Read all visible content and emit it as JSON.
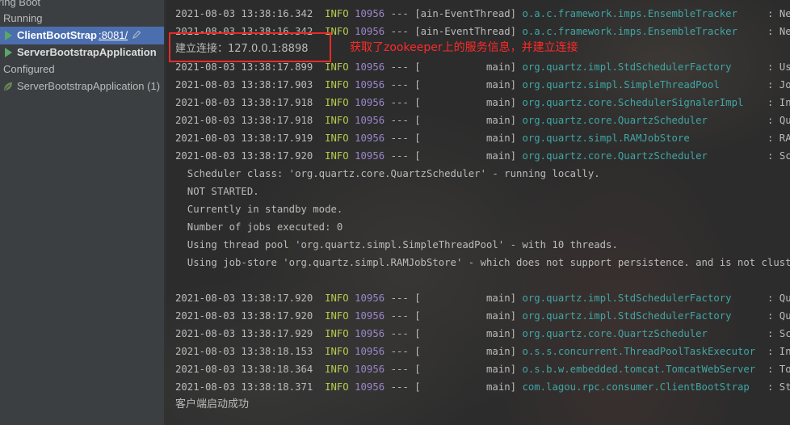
{
  "sidebar": {
    "items": [
      {
        "label": "ring Boot"
      },
      {
        "label": "Running"
      },
      {
        "label": "ClientBootStrap",
        "port": ":8081/"
      },
      {
        "label": "ServerBootstrapApplication"
      },
      {
        "label": "Configured"
      },
      {
        "label": "ServerBootstrapApplication (1)"
      }
    ]
  },
  "console": {
    "lines": [
      {
        "ts": "2021-08-03 13:38:16.342",
        "level": "INFO",
        "pid": "10956",
        "sep": "---",
        "thread": "[ain-EventThread]",
        "logger": "o.a.c.framework.imps.EnsembleTracker",
        "msg": ": New conf"
      },
      {
        "ts": "2021-08-03 13:38:16.342",
        "level": "INFO",
        "pid": "10956",
        "sep": "---",
        "thread": "[ain-EventThread]",
        "logger": "o.a.c.framework.imps.EnsembleTracker",
        "msg": ": New conf"
      },
      {
        "text": "建立连接：127.0.0.1:8898"
      },
      {
        "ts": "2021-08-03 13:38:17.899",
        "level": "INFO",
        "pid": "10956",
        "sep": "---",
        "thread": "[           main]",
        "logger": "org.quartz.impl.StdSchedulerFactory",
        "msg": ": Using de"
      },
      {
        "ts": "2021-08-03 13:38:17.903",
        "level": "INFO",
        "pid": "10956",
        "sep": "---",
        "thread": "[           main]",
        "logger": "org.quartz.simpl.SimpleThreadPool",
        "msg": ": Job exec"
      },
      {
        "ts": "2021-08-03 13:38:17.918",
        "level": "INFO",
        "pid": "10956",
        "sep": "---",
        "thread": "[           main]",
        "logger": "org.quartz.core.SchedulerSignalerImpl",
        "msg": ": Initiali"
      },
      {
        "ts": "2021-08-03 13:38:17.918",
        "level": "INFO",
        "pid": "10956",
        "sep": "---",
        "thread": "[           main]",
        "logger": "org.quartz.core.QuartzScheduler",
        "msg": ": Quartz S"
      },
      {
        "ts": "2021-08-03 13:38:17.919",
        "level": "INFO",
        "pid": "10956",
        "sep": "---",
        "thread": "[           main]",
        "logger": "org.quartz.simpl.RAMJobStore",
        "msg": ": RAMJobSto"
      },
      {
        "ts": "2021-08-03 13:38:17.920",
        "level": "INFO",
        "pid": "10956",
        "sep": "---",
        "thread": "[           main]",
        "logger": "org.quartz.core.QuartzScheduler",
        "msg": ": Schedule"
      },
      {
        "text": "  Scheduler class: 'org.quartz.core.QuartzScheduler' - running locally."
      },
      {
        "text": "  NOT STARTED."
      },
      {
        "text": "  Currently in standby mode."
      },
      {
        "text": "  Number of jobs executed: 0"
      },
      {
        "text": "  Using thread pool 'org.quartz.simpl.SimpleThreadPool' - with 10 threads."
      },
      {
        "text": "  Using job-store 'org.quartz.simpl.RAMJobStore' - which does not support persistence. and is not clustered."
      },
      {
        "text": ""
      },
      {
        "ts": "2021-08-03 13:38:17.920",
        "level": "INFO",
        "pid": "10956",
        "sep": "---",
        "thread": "[           main]",
        "logger": "org.quartz.impl.StdSchedulerFactory",
        "msg": ": Quartz s"
      },
      {
        "ts": "2021-08-03 13:38:17.920",
        "level": "INFO",
        "pid": "10956",
        "sep": "---",
        "thread": "[           main]",
        "logger": "org.quartz.impl.StdSchedulerFactory",
        "msg": ": Quartz s"
      },
      {
        "ts": "2021-08-03 13:38:17.929",
        "level": "INFO",
        "pid": "10956",
        "sep": "---",
        "thread": "[           main]",
        "logger": "org.quartz.core.QuartzScheduler",
        "msg": ": Schedule"
      },
      {
        "ts": "2021-08-03 13:38:18.153",
        "level": "INFO",
        "pid": "10956",
        "sep": "---",
        "thread": "[           main]",
        "logger": "o.s.s.concurrent.ThreadPoolTaskExecutor",
        "msg": ": Initiali"
      },
      {
        "ts": "2021-08-03 13:38:18.364",
        "level": "INFO",
        "pid": "10956",
        "sep": "---",
        "thread": "[           main]",
        "logger": "o.s.b.w.embedded.tomcat.TomcatWebServer",
        "msg": ": Tomcat s"
      },
      {
        "ts": "2021-08-03 13:38:18.371",
        "level": "INFO",
        "pid": "10956",
        "sep": "---",
        "thread": "[           main]",
        "logger": "com.lagou.rpc.consumer.ClientBootStrap",
        "msg": ": Started"
      },
      {
        "text": "客户端启动成功"
      }
    ]
  },
  "annotation": {
    "text": "获取了zookeeper上的服务信息，并建立连接",
    "color": "#ff2a2a"
  },
  "colors": {
    "selection": "#4b6eaf",
    "run_icon": "#59a869",
    "log_level": "#b8c94e",
    "pid": "#9a86c8",
    "logger": "#3fa6a4"
  },
  "icons": {
    "running_app": "run-icon",
    "configured_app": "spring-leaf-icon",
    "port_edit": "pencil-icon"
  }
}
